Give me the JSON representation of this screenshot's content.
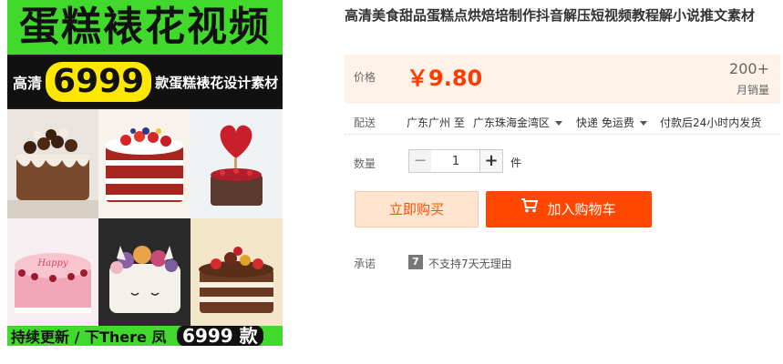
{
  "image": {
    "banner_title": "蛋糕裱花视频",
    "banner_hd": "高清",
    "banner_count": "6999",
    "banner_sub": "款蛋糕裱花设计素材",
    "banner_bottom": "持续更新 / 下There 凤",
    "banner_bottom_num": "6999 款"
  },
  "product": {
    "title": "高清美食甜品蛋糕点烘焙培制作抖音解压短视频教程解小说推文素材"
  },
  "price": {
    "label": "价格",
    "value": "￥9.80",
    "sales_count": "200+",
    "sales_label": "月销量"
  },
  "delivery": {
    "label": "配送",
    "from": "广东广州 至",
    "to": "广东珠海金湾区",
    "fee": "快递 免运费",
    "time": "付款后24小时内发货"
  },
  "quantity": {
    "label": "数量",
    "value": "1",
    "unit": "件",
    "minus": "−",
    "plus": "+"
  },
  "actions": {
    "buy_now": "立即购买",
    "add_cart": "加入购物车"
  },
  "promise": {
    "label": "承诺",
    "icon_text": "7",
    "text": "不支持7天无理由"
  },
  "colors": {
    "accent": "#ff4700",
    "price": "#ff3c00",
    "banner_green": "#42d92d",
    "banner_yellow": "#ffe800"
  }
}
